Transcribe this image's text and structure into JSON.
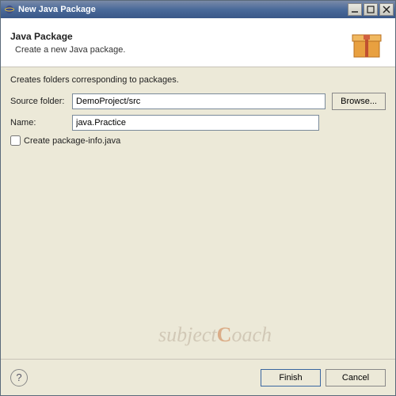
{
  "titlebar": {
    "title": "New Java Package"
  },
  "banner": {
    "title": "Java Package",
    "subtitle": "Create a new Java package."
  },
  "form": {
    "description": "Creates folders corresponding to packages.",
    "source_label": "Source folder:",
    "source_value": "DemoProject/src",
    "browse_label": "Browse...",
    "name_label": "Name:",
    "name_value": "java.Practice",
    "pkginfo_label": "Create package-info.java"
  },
  "footer": {
    "finish": "Finish",
    "cancel": "Cancel"
  },
  "watermark": {
    "part1": "subject",
    "part2": "C",
    "part3": "oach"
  }
}
